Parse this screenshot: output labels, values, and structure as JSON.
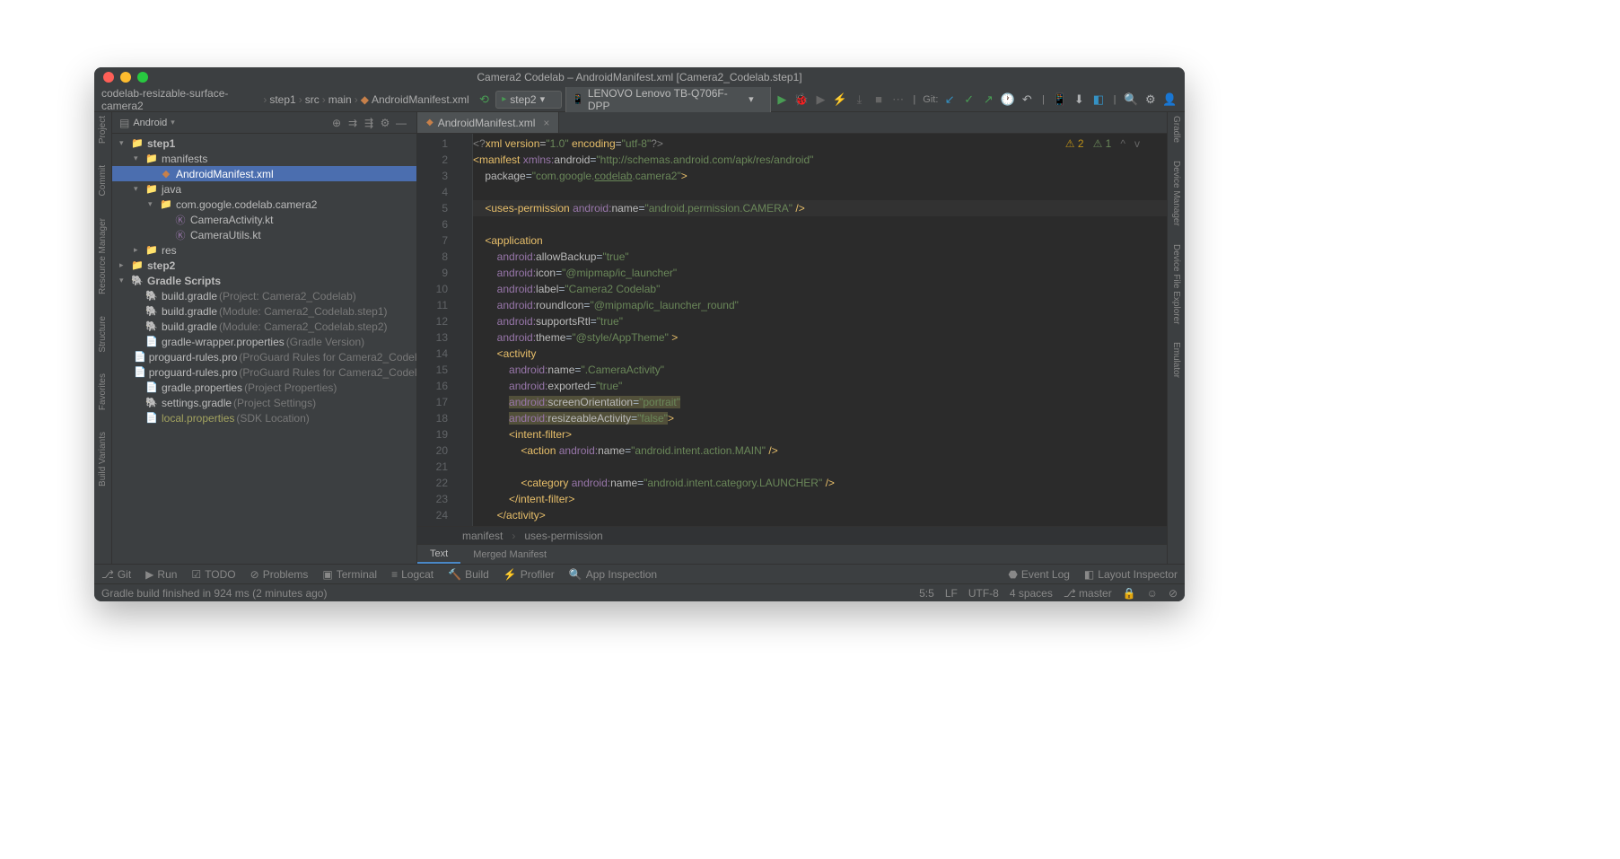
{
  "title": "Camera2 Codelab – AndroidManifest.xml [Camera2_Codelab.step1]",
  "breadcrumb": [
    "codelab-resizable-surface-camera2",
    "step1",
    "src",
    "main",
    "AndroidManifest.xml"
  ],
  "run_config": "step2",
  "device": "LENOVO Lenovo TB-Q706F-DPP",
  "vcs_label": "Git:",
  "sidebar": {
    "title": "Android",
    "tree": [
      {
        "d": 0,
        "ar": "v",
        "ic": "fo",
        "nm": "step1",
        "bold": true
      },
      {
        "d": 1,
        "ar": "v",
        "ic": "fo",
        "nm": "manifests"
      },
      {
        "d": 2,
        "ar": "",
        "ic": "xm",
        "nm": "AndroidManifest.xml",
        "sel": true
      },
      {
        "d": 1,
        "ar": "v",
        "ic": "fo",
        "nm": "java"
      },
      {
        "d": 2,
        "ar": "v",
        "ic": "fo",
        "nm": "com.google.codelab.camera2"
      },
      {
        "d": 3,
        "ar": "",
        "ic": "kt",
        "nm": "CameraActivity.kt"
      },
      {
        "d": 3,
        "ar": "",
        "ic": "kt",
        "nm": "CameraUtils.kt"
      },
      {
        "d": 1,
        "ar": ">",
        "ic": "fo",
        "nm": "res"
      },
      {
        "d": 0,
        "ar": ">",
        "ic": "fo",
        "nm": "step2",
        "bold": true
      },
      {
        "d": 0,
        "ar": "v",
        "ic": "gr",
        "nm": "Gradle Scripts",
        "bold": true
      },
      {
        "d": 1,
        "ar": "",
        "ic": "gr",
        "nm": "build.gradle",
        "hint": " (Project: Camera2_Codelab)"
      },
      {
        "d": 1,
        "ar": "",
        "ic": "gr",
        "nm": "build.gradle",
        "hint": " (Module: Camera2_Codelab.step1)"
      },
      {
        "d": 1,
        "ar": "",
        "ic": "gr",
        "nm": "build.gradle",
        "hint": " (Module: Camera2_Codelab.step2)"
      },
      {
        "d": 1,
        "ar": "",
        "ic": "pr",
        "nm": "gradle-wrapper.properties",
        "hint": " (Gradle Version)"
      },
      {
        "d": 1,
        "ar": "",
        "ic": "pr",
        "nm": "proguard-rules.pro",
        "hint": " (ProGuard Rules for Camera2_Codel"
      },
      {
        "d": 1,
        "ar": "",
        "ic": "pr",
        "nm": "proguard-rules.pro",
        "hint": " (ProGuard Rules for Camera2_Codel"
      },
      {
        "d": 1,
        "ar": "",
        "ic": "pr",
        "nm": "gradle.properties",
        "hint": " (Project Properties)"
      },
      {
        "d": 1,
        "ar": "",
        "ic": "gr",
        "nm": "settings.gradle",
        "hint": " (Project Settings)"
      },
      {
        "d": 1,
        "ar": "",
        "ic": "pr",
        "nm": "local.properties",
        "hint": " (SDK Location)",
        "dim": true
      }
    ]
  },
  "left_rails": [
    "Project",
    "Commit",
    "Resource Manager",
    "Structure",
    "Favorites",
    "Build Variants"
  ],
  "right_rails": [
    "Gradle",
    "Device Manager",
    "Device File Explorer",
    "Emulator"
  ],
  "editor": {
    "tab": "AndroidManifest.xml",
    "warnings": {
      "w": "2",
      "weak": "1"
    },
    "crumbs": [
      "manifest",
      "uses-permission"
    ],
    "subtabs": [
      "Text",
      "Merged Manifest"
    ]
  },
  "bottom": [
    "Git",
    "Run",
    "TODO",
    "Problems",
    "Terminal",
    "Logcat",
    "Build",
    "Profiler",
    "App Inspection"
  ],
  "bottom_right": [
    "Event Log",
    "Layout Inspector"
  ],
  "status": {
    "msg": "Gradle build finished in 924 ms (2 minutes ago)",
    "pos": "5:5",
    "le": "LF",
    "enc": "UTF-8",
    "indent": "4 spaces",
    "branch": "master"
  },
  "code_lines": [
    {
      "n": 1,
      "html": "<span class='cm'>&lt;?</span><span class='tag'>xml version</span><span class='attr'>=</span><span class='val'>\"1.0\"</span> <span class='tag'>encoding</span><span class='attr'>=</span><span class='val'>\"utf-8\"</span><span class='cm'>?&gt;</span>"
    },
    {
      "n": 2,
      "html": "<span class='tag'>&lt;manifest</span> <span class='ns'>xmlns:</span><span class='attr'>android</span>=<span class='val'>\"http://schemas.android.com/apk/res/android\"</span>"
    },
    {
      "n": 3,
      "html": "    <span class='attr'>package</span>=<span class='val'>\"com.google.<u>codelab</u>.camera2\"</span><span class='tag'>&gt;</span>"
    },
    {
      "n": 4,
      "html": ""
    },
    {
      "n": 5,
      "hl": true,
      "html": "    <span class='tag'>&lt;uses-permission</span> <span class='ns'>android:</span><span class='attr'>name</span>=<span class='val'>\"android.permission.CAMERA\"</span> <span class='tag'>/&gt;</span>"
    },
    {
      "n": 6,
      "html": ""
    },
    {
      "n": 7,
      "html": "    <span class='tag'>&lt;application</span>"
    },
    {
      "n": 8,
      "html": "        <span class='ns'>android:</span><span class='attr'>allowBackup</span>=<span class='val'>\"true\"</span>"
    },
    {
      "n": 9,
      "html": "        <span class='ns'>android:</span><span class='attr'>icon</span>=<span class='val'>\"@mipmap/ic_launcher\"</span>"
    },
    {
      "n": 10,
      "html": "        <span class='ns'>android:</span><span class='attr'>label</span>=<span class='val'>\"Camera2 Codelab\"</span>"
    },
    {
      "n": 11,
      "html": "        <span class='ns'>android:</span><span class='attr'>roundIcon</span>=<span class='val'>\"@mipmap/ic_launcher_round\"</span>"
    },
    {
      "n": 12,
      "html": "        <span class='ns'>android:</span><span class='attr'>supportsRtl</span>=<span class='val'>\"true\"</span>"
    },
    {
      "n": 13,
      "html": "        <span class='ns'>android:</span><span class='attr'>theme</span>=<span class='val'>\"@style/AppTheme\"</span> <span class='tag'>&gt;</span>"
    },
    {
      "n": 14,
      "html": "        <span class='tag'>&lt;activity</span>"
    },
    {
      "n": 15,
      "html": "            <span class='ns'>android:</span><span class='attr'>name</span>=<span class='val'>\".CameraActivity\"</span>"
    },
    {
      "n": 16,
      "html": "            <span class='ns'>android:</span><span class='attr'>exported</span>=<span class='val'>\"true\"</span>"
    },
    {
      "n": 17,
      "html": "            <span class='warn'><span class='ns'>android:</span><span class='attr'>screenOrientation</span>=<span class='val'>\"portrait\"</span></span>"
    },
    {
      "n": 18,
      "html": "            <span class='warn'><span class='ns'>android:</span><span class='attr'>resizeableActivity</span>=<span class='val'>\"false\"</span></span><span class='tag'>&gt;</span>"
    },
    {
      "n": 19,
      "html": "            <span class='tag'>&lt;intent-filter&gt;</span>"
    },
    {
      "n": 20,
      "html": "                <span class='tag'>&lt;action</span> <span class='ns'>android:</span><span class='attr'>name</span>=<span class='val'>\"android.intent.action.MAIN\"</span> <span class='tag'>/&gt;</span>"
    },
    {
      "n": 21,
      "html": ""
    },
    {
      "n": 22,
      "html": "                <span class='tag'>&lt;category</span> <span class='ns'>android:</span><span class='attr'>name</span>=<span class='val'>\"android.intent.category.LAUNCHER\"</span> <span class='tag'>/&gt;</span>"
    },
    {
      "n": 23,
      "html": "            <span class='tag'>&lt;/intent-filter&gt;</span>"
    },
    {
      "n": 24,
      "html": "        <span class='tag'>&lt;/activity&gt;</span>"
    }
  ]
}
